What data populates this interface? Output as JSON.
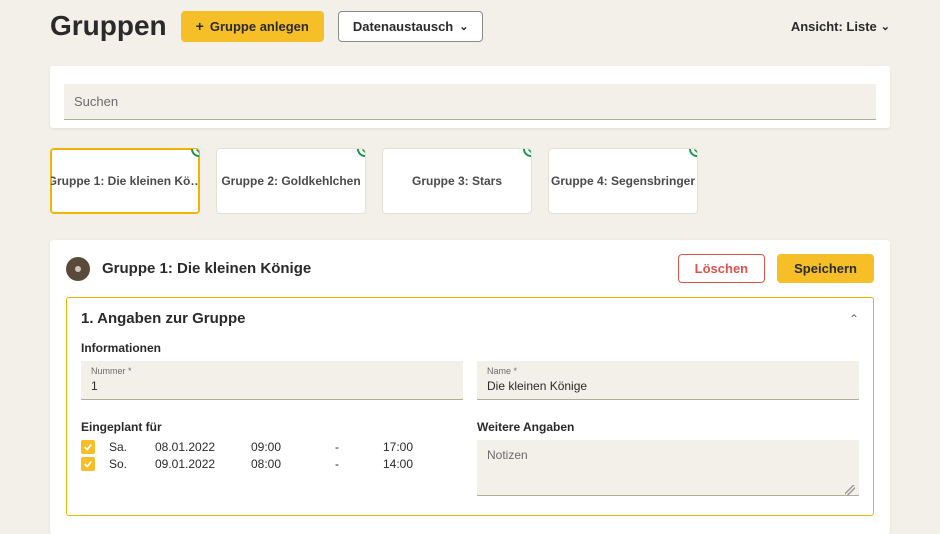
{
  "header": {
    "title": "Gruppen",
    "create_label": "Gruppe anlegen",
    "exchange_label": "Datenaustausch",
    "view_label": "Ansicht: Liste"
  },
  "search": {
    "placeholder": "Suchen"
  },
  "cards": [
    {
      "label": "Gruppe 1: Die kleinen Kö…",
      "selected": true
    },
    {
      "label": "Gruppe 2: Goldkehlchen",
      "selected": false
    },
    {
      "label": "Gruppe 3: Stars",
      "selected": false
    },
    {
      "label": "Gruppe 4: Segensbringer",
      "selected": false
    }
  ],
  "detail": {
    "title": "Gruppe 1: Die kleinen Könige",
    "delete_label": "Löschen",
    "save_label": "Speichern",
    "section_title": "1. Angaben zur Gruppe",
    "info_heading": "Informationen",
    "fields": {
      "nummer_label": "Nummer *",
      "nummer_value": "1",
      "name_label": "Name *",
      "name_value": "Die kleinen Könige"
    },
    "eingeplant_heading": "Eingeplant für",
    "schedule": [
      {
        "day": "Sa.",
        "date": "08.01.2022",
        "start": "09:00",
        "dash": "-",
        "end": "17:00"
      },
      {
        "day": "So.",
        "date": "09.01.2022",
        "start": "08:00",
        "dash": "-",
        "end": "14:00"
      }
    ],
    "weitere_heading": "Weitere Angaben",
    "notes_placeholder": "Notizen"
  }
}
